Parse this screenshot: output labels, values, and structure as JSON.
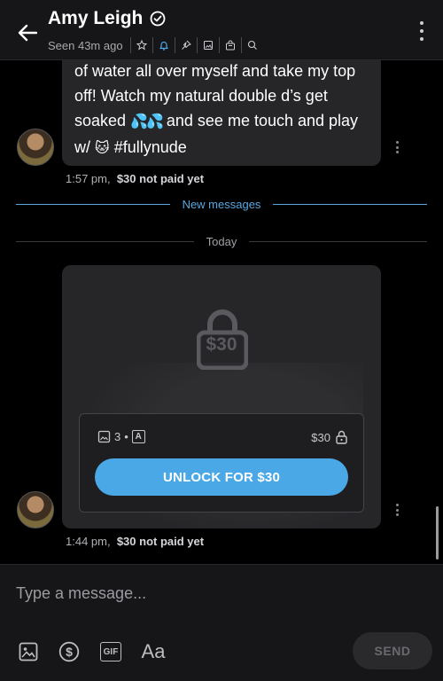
{
  "header": {
    "name": "Amy Leigh",
    "seen": "Seen 43m ago",
    "icons": [
      "star-icon",
      "bell-icon",
      "pin-icon",
      "image-icon",
      "bag-icon",
      "search-icon"
    ]
  },
  "messages": [
    {
      "text": "of water all over myself and take my top off! Watch my natural double d’s get soaked 💦💦 and see me touch and play w/ 🐱 #fullynude",
      "text_part1": "of water all over myself and take my top off! Watch my natural double d’s get soaked ",
      "emoji_drops": "💦💦",
      "text_part2": " and see me touch and play w/ ",
      "emoji_cat": "🐱",
      "text_part3": " #fullynude",
      "time": "1:57 pm,",
      "status": "$30 not paid yet"
    }
  ],
  "dividers": {
    "new_messages": "New messages",
    "today": "Today"
  },
  "ppv": {
    "price_badge": "$30",
    "media_count": "3",
    "separator": "•",
    "text_badge": "A",
    "price": "$30",
    "unlock_label": "UNLOCK FOR $30",
    "time": "1:44 pm,",
    "status": "$30 not paid yet"
  },
  "composer": {
    "placeholder": "Type a message...",
    "gif_label": "GIF",
    "font_label": "Aa",
    "send_label": "SEND"
  },
  "colors": {
    "accent": "#4aa8e6",
    "background": "#000000",
    "bubble": "#262629"
  }
}
